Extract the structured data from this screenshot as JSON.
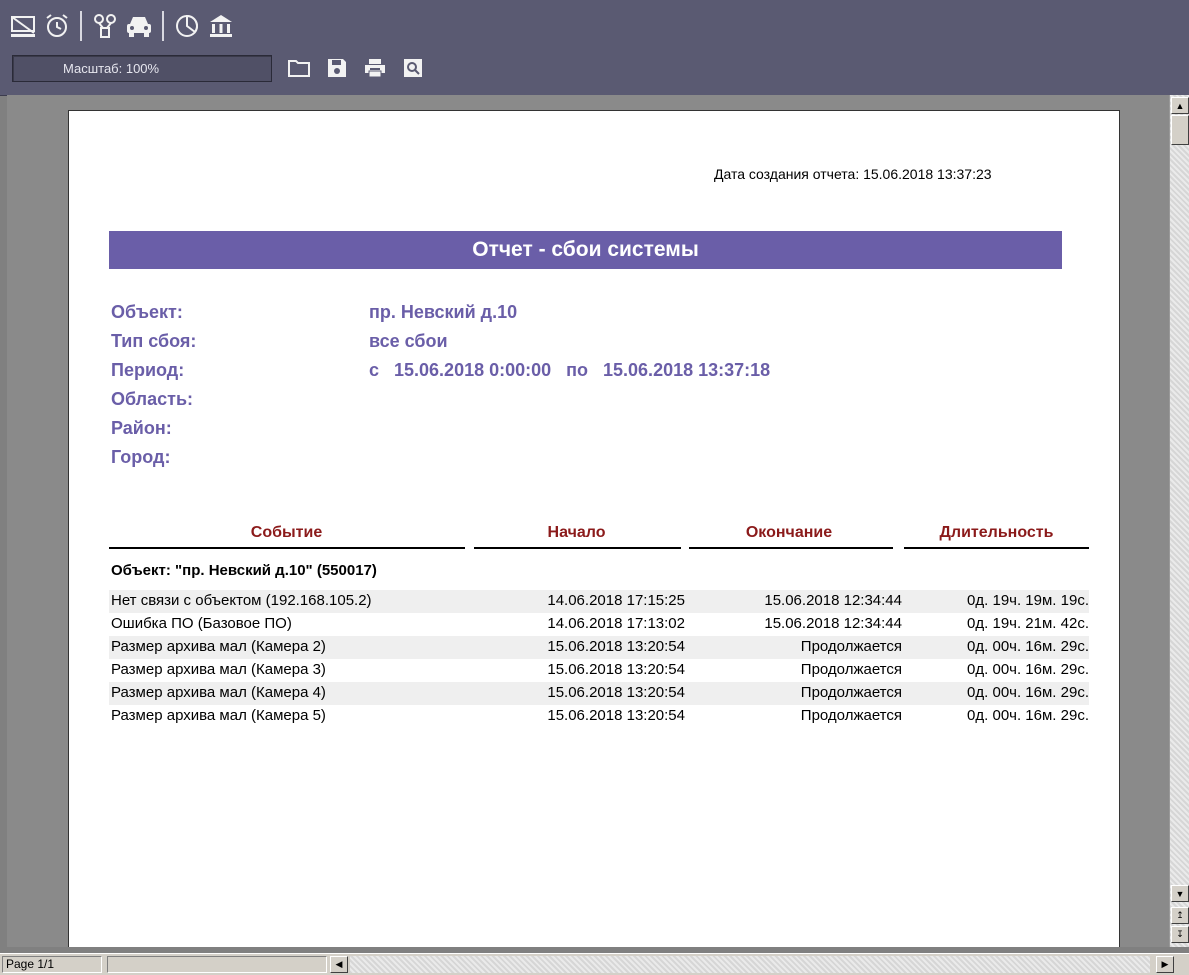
{
  "toolbar": {
    "icons": [
      "monitor-off-icon",
      "alarm-clock-icon",
      "network-icon",
      "car-icon",
      "pie-chart-icon",
      "bank-icon"
    ],
    "zoom_label": "Масштаб: 100%",
    "file_actions": [
      "open-folder-icon",
      "save-icon",
      "print-icon",
      "preview-icon"
    ]
  },
  "report": {
    "created_label": "Дата создания отчета: 15.06.2018 13:37:23",
    "title": "Отчет - сбои системы",
    "meta": [
      {
        "key": "Объект:",
        "value": "пр. Невский д.10"
      },
      {
        "key": "Тип сбоя:",
        "value": "все сбои"
      },
      {
        "key": "Период:",
        "value": "с   15.06.2018 0:00:00   по   15.06.2018 13:37:18"
      },
      {
        "key": "Область:",
        "value": ""
      },
      {
        "key": "Район:",
        "value": ""
      },
      {
        "key": "Город:",
        "value": ""
      }
    ],
    "columns": [
      "Событие",
      "Начало",
      "Окончание",
      "Длительность"
    ],
    "group_title": "Объект: \"пр. Невский д.10\" (550017)",
    "rows": [
      {
        "event": "Нет связи с объектом (192.168.105.2)",
        "start": "14.06.2018 17:15:25",
        "end": "15.06.2018 12:34:44",
        "duration": "0д. 19ч. 19м. 19с."
      },
      {
        "event": "Ошибка ПО (Базовое ПО)",
        "start": "14.06.2018 17:13:02",
        "end": "15.06.2018 12:34:44",
        "duration": "0д. 19ч. 21м. 42с."
      },
      {
        "event": "Размер архива мал (Камера 2)",
        "start": "15.06.2018 13:20:54",
        "end": "Продолжается",
        "duration": "0д. 00ч. 16м. 29с."
      },
      {
        "event": "Размер архива мал (Камера 3)",
        "start": "15.06.2018 13:20:54",
        "end": "Продолжается",
        "duration": "0д. 00ч. 16м. 29с."
      },
      {
        "event": "Размер архива мал (Камера 4)",
        "start": "15.06.2018 13:20:54",
        "end": "Продолжается",
        "duration": "0д. 00ч. 16м. 29с."
      },
      {
        "event": "Размер архива мал (Камера 5)",
        "start": "15.06.2018 13:20:54",
        "end": "Продолжается",
        "duration": "0д. 00ч. 16м. 29с."
      }
    ]
  },
  "status": {
    "page": "Page 1/1"
  },
  "colors": {
    "accent": "#6a5ea8",
    "header_text": "#8b1a1a",
    "toolbar_bg": "#5a5a72"
  }
}
